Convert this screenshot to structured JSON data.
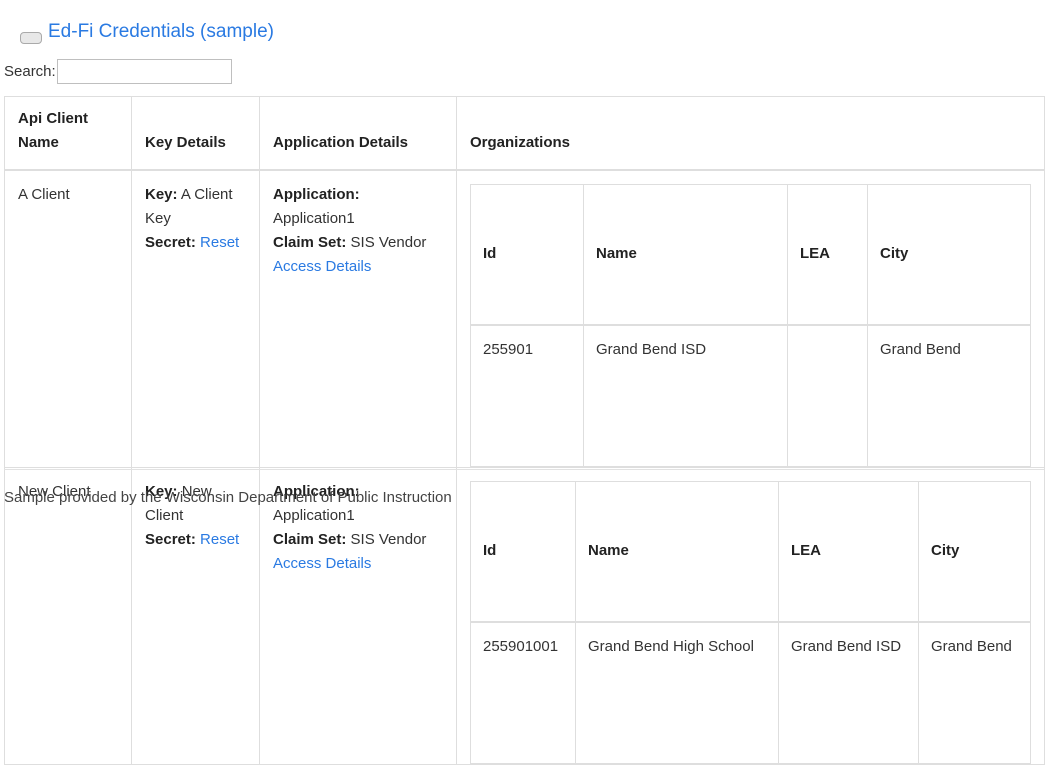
{
  "page": {
    "title": "Ed-Fi Credentials (sample)",
    "search_label": "Search:",
    "search_value": "",
    "footer": "Sample provided by the Wisconsin Department of Public Instruction"
  },
  "table": {
    "headers": [
      "Api Client Name",
      "Key Details",
      "Application Details",
      "Organizations"
    ],
    "rows": [
      {
        "client_name": "A Client",
        "key_label": "Key:",
        "key_value": "A Client Key",
        "secret_label": "Secret:",
        "secret_link": "Reset",
        "application_label": "Application:",
        "application_value": "Application1",
        "claimset_label": "Claim Set:",
        "claimset_value": "SIS Vendor",
        "access_link": "Access Details",
        "org_headers": [
          "Id",
          "Name",
          "LEA",
          "City"
        ],
        "orgs": [
          {
            "id": "255901",
            "name": "Grand Bend ISD",
            "lea": "",
            "city": "Grand Bend"
          }
        ]
      },
      {
        "client_name": "New Client",
        "key_label": "Key:",
        "key_value": "New Client",
        "secret_label": "Secret:",
        "secret_link": "Reset",
        "application_label": "Application:",
        "application_value": "Application1",
        "claimset_label": "Claim Set:",
        "claimset_value": "SIS Vendor",
        "access_link": "Access Details",
        "org_headers": [
          "Id",
          "Name",
          "LEA",
          "City"
        ],
        "orgs": [
          {
            "id": "255901001",
            "name": "Grand Bend High School",
            "lea": "Grand Bend ISD",
            "city": "Grand Bend"
          }
        ]
      }
    ]
  },
  "colors": {
    "link": "#2a7ae2",
    "border": "#dedede",
    "text": "#333333"
  }
}
